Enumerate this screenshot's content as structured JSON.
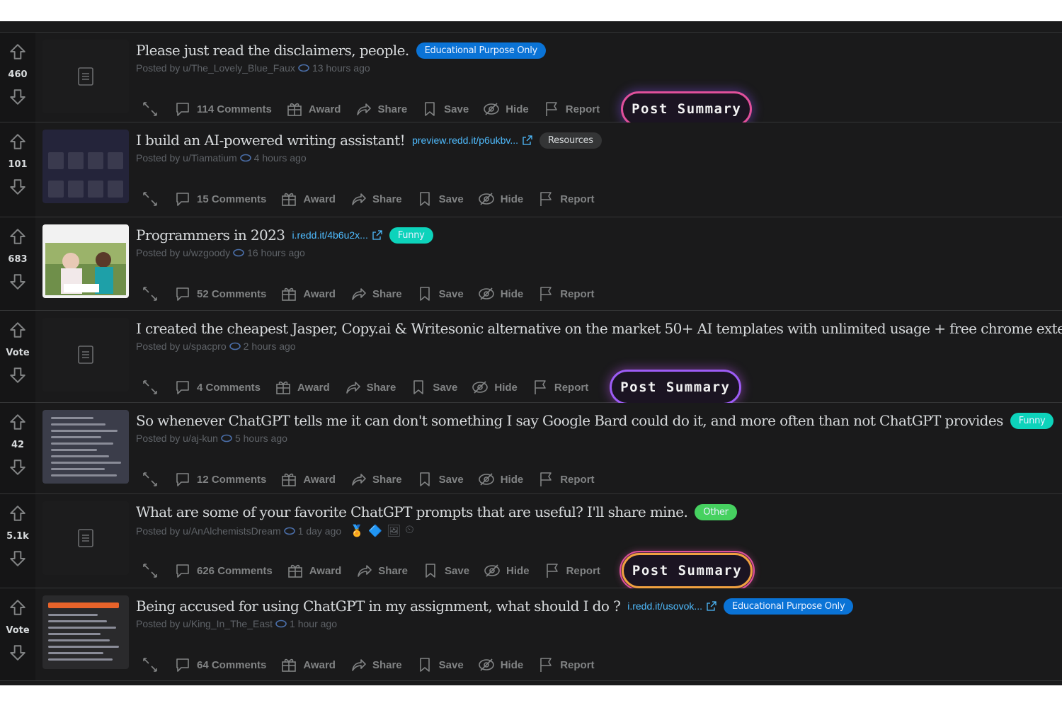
{
  "posts": [
    {
      "score": "460",
      "title": "Please just read the disclaimers, people.",
      "link": "",
      "flair": {
        "text": "Educational Purpose Only",
        "color": "#0a73d6"
      },
      "author": "Posted by u/The_Lovely_Blue_Faux",
      "time": "13 hours ago",
      "comments": "114 Comments",
      "summary": "Post Summary",
      "summary_style": "pink",
      "thumb": "text-post"
    },
    {
      "score": "101",
      "title": "I build an AI-powered writing assistant!",
      "link": "preview.redd.it/p6ukbv...",
      "flair": {
        "text": "Resources",
        "color": "#343536"
      },
      "author": "Posted by u/Tiamatium",
      "time": "4 hours ago",
      "comments": "15 Comments",
      "summary": "",
      "thumb": "ui-grid"
    },
    {
      "score": "683",
      "title": "Programmers in 2023",
      "link": "i.redd.it/4b6u2x...",
      "flair": {
        "text": "Funny",
        "color": "#0dd3bb"
      },
      "author": "Posted by u/wzgoody",
      "time": "16 hours ago",
      "comments": "52 Comments",
      "summary": "",
      "thumb": "photo"
    },
    {
      "score": "Vote",
      "title": "I created the cheapest Jasper, Copy.ai & Writesonic alternative on the market 50+ AI templates with unlimited usage + free chrome extension",
      "link": "",
      "flair": null,
      "author": "Posted by u/spacpro",
      "time": "2 hours ago",
      "comments": "4 Comments",
      "summary": "Post Summary",
      "summary_style": "purple",
      "thumb": "text-post"
    },
    {
      "score": "42",
      "title": "So whenever ChatGPT tells me it can don't something I say Google Bard could do it, and more often than not ChatGPT provides",
      "link": "",
      "flair": {
        "text": "Funny",
        "color": "#0dd3bb"
      },
      "author": "Posted by u/aj-kun",
      "time": "5 hours ago",
      "comments": "12 Comments",
      "summary": "",
      "thumb": "text-shot"
    },
    {
      "score": "5.1k",
      "title": "What are some of your favorite ChatGPT prompts that are useful? I'll share mine.",
      "link": "",
      "flair": {
        "text": "Other",
        "color": "#46d160"
      },
      "author": "Posted by u/AnAlchemistsDream",
      "time": "1 day ago",
      "comments": "626 Comments",
      "summary": "Post Summary",
      "summary_style": "orange",
      "thumb": "text-post",
      "awards": [
        "🏅",
        "🔷",
        "🖼",
        "⏲"
      ]
    },
    {
      "score": "Vote",
      "title": "Being accused for using ChatGPT in my assignment, what should I do ?",
      "link": "i.redd.it/usovok...",
      "flair": {
        "text": "Educational Purpose Only",
        "color": "#0a73d6"
      },
      "author": "Posted by u/King_In_The_East",
      "time": "1 hour ago",
      "comments": "64 Comments",
      "summary": "",
      "thumb": "doc-shot"
    }
  ],
  "actions": {
    "award": "Award",
    "share": "Share",
    "save": "Save",
    "hide": "Hide",
    "report": "Report"
  },
  "colors": {
    "background": "#1a1a1b",
    "link": "#4fbcff",
    "muted": "#818384"
  }
}
